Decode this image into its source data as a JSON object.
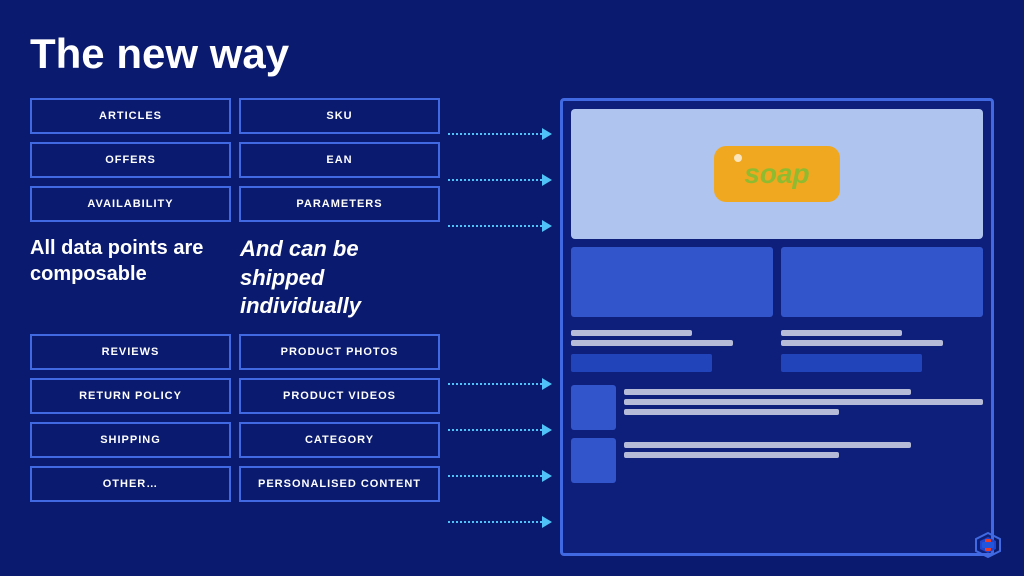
{
  "title": "The new way",
  "top_boxes_left": [
    {
      "label": "ARTICLES"
    },
    {
      "label": "OFFERS"
    },
    {
      "label": "AVAILABILITY"
    }
  ],
  "top_boxes_right": [
    {
      "label": "SKU"
    },
    {
      "label": "EAN"
    },
    {
      "label": "PARAMETERS"
    }
  ],
  "middle_text_left": "All data points are composable",
  "middle_text_right": "And can be shipped individually",
  "bottom_boxes_left": [
    {
      "label": "REVIEWS"
    },
    {
      "label": "RETURN POLICY"
    },
    {
      "label": "SHIPPING"
    },
    {
      "label": "OTHER…"
    }
  ],
  "bottom_boxes_right": [
    {
      "label": "PRODUCT PHOTOS"
    },
    {
      "label": "PRODUCT VIDEOS"
    },
    {
      "label": "CATEGORY"
    },
    {
      "label": "PERSONALISED CONTENT"
    }
  ],
  "soap_label": "soap",
  "logo_colors": [
    "#e63b2e",
    "#2255dd"
  ]
}
